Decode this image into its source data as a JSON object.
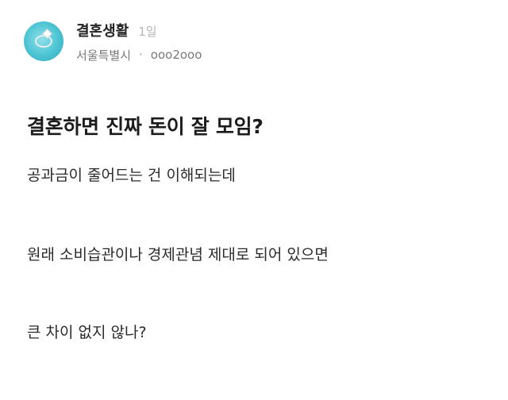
{
  "header": {
    "author_name": "결혼생활",
    "post_time": "1일",
    "location": "서울특별시",
    "separator": "·",
    "user_id": "ooo2ooo"
  },
  "post": {
    "title": "결혼하면 진짜 돈이 잘 모임?",
    "lines": [
      "공과금이 줄어드는 건 이해되는데",
      "원래 소비습관이나 경제관념 제대로 되어 있으면",
      "큰 차이 없지 않나?"
    ]
  }
}
